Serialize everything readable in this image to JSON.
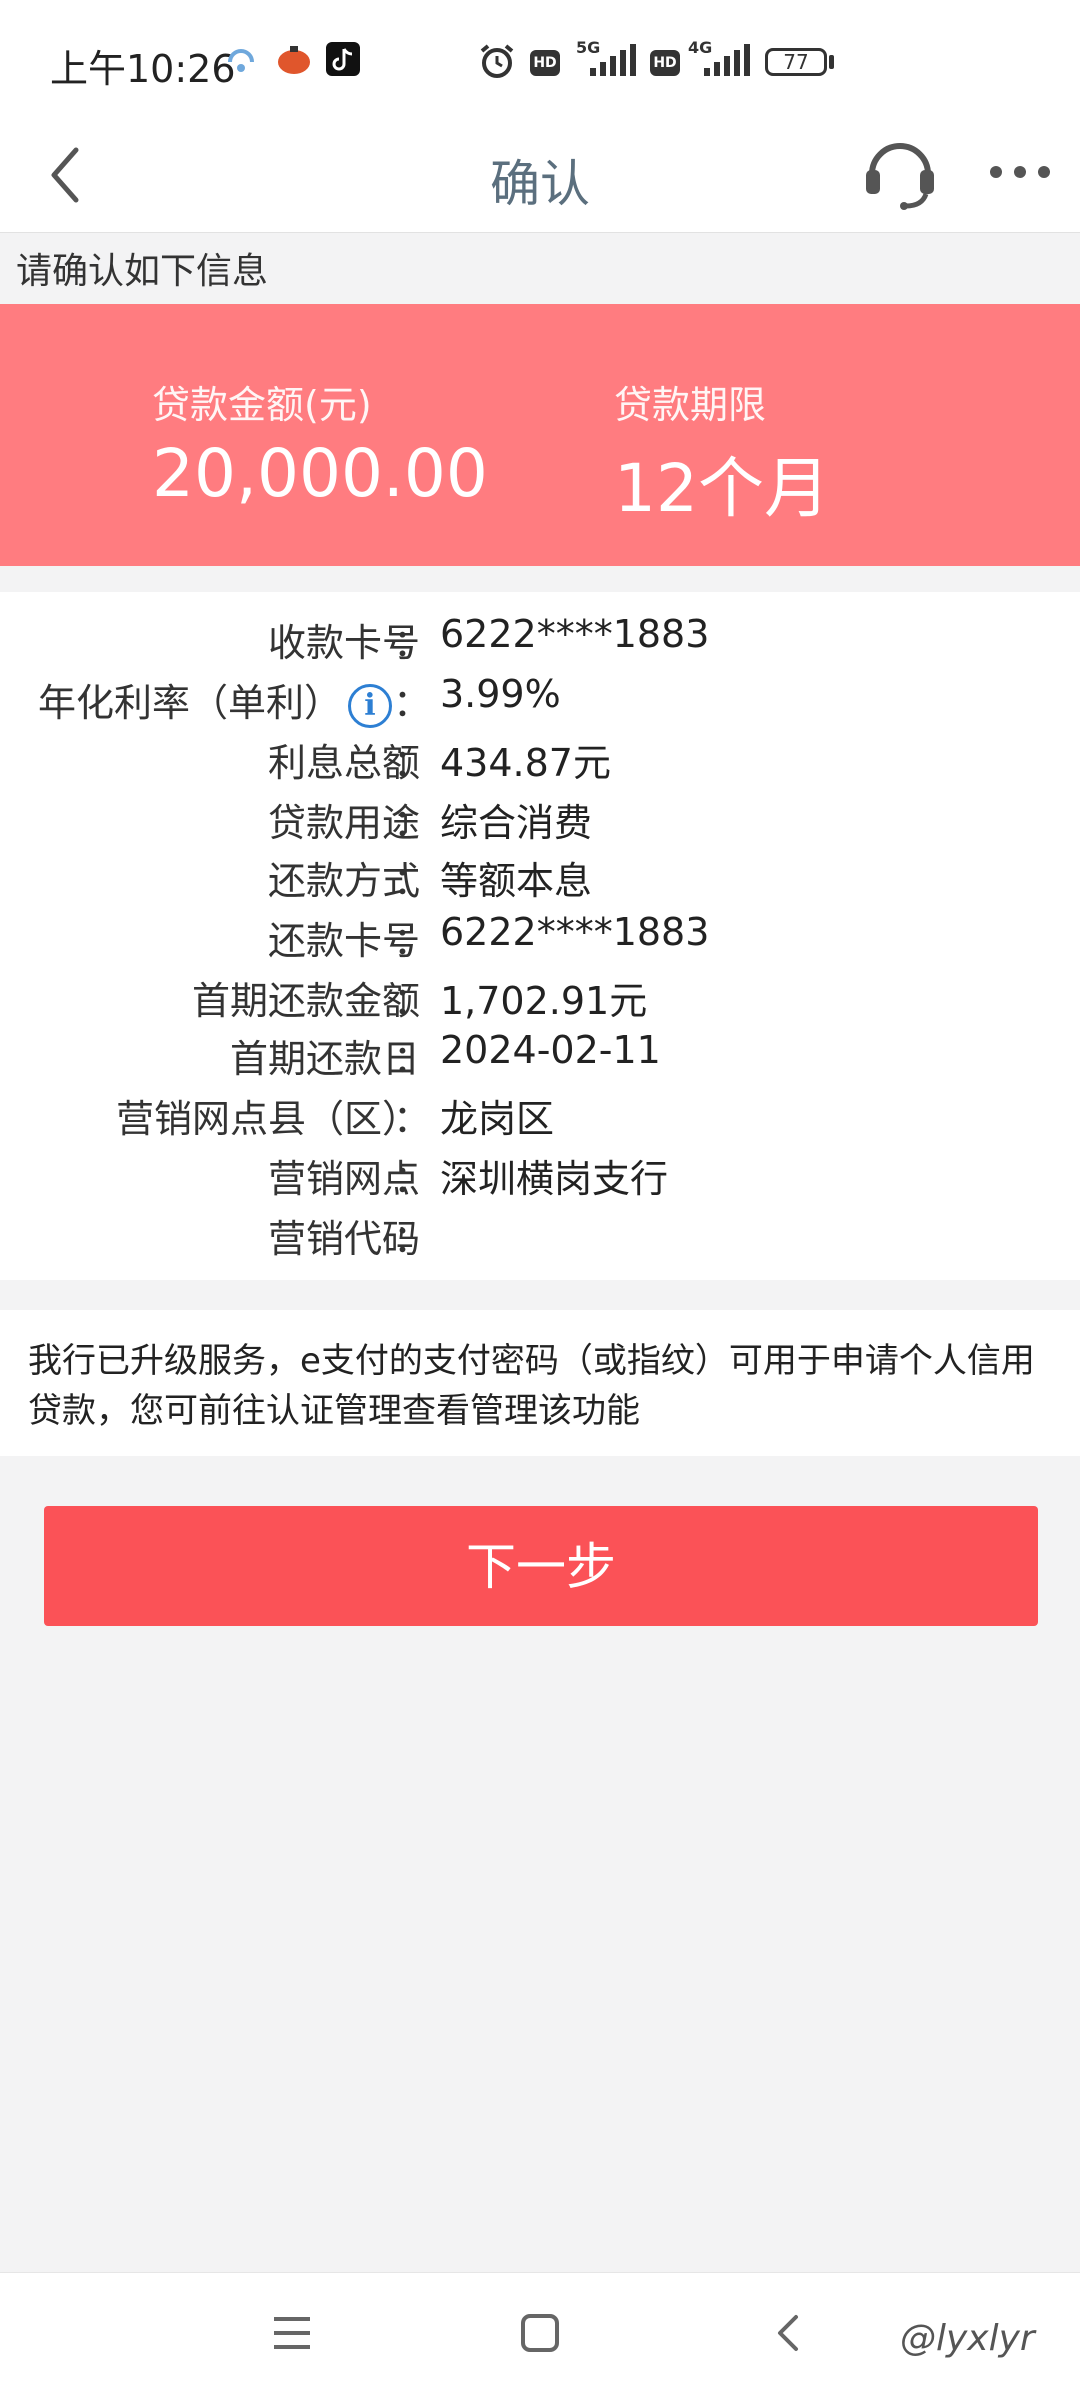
{
  "status_bar": {
    "time": "上午10:26",
    "battery": "77",
    "net1": "5G",
    "net2": "4G",
    "hd": "HD"
  },
  "nav": {
    "title": "确认"
  },
  "confirm_hint": "请确认如下信息",
  "summary": {
    "amount_label": "贷款金额(元)",
    "amount_value": "20,000.00",
    "term_label": "贷款期限",
    "term_value": "12个月"
  },
  "details": [
    {
      "label": "收款卡号",
      "value": "6222****1883"
    },
    {
      "label": "年化利率（单利）",
      "value": "3.99%"
    },
    {
      "label": "利息总额",
      "value": "434.87元"
    },
    {
      "label": "贷款用途",
      "value": "综合消费"
    },
    {
      "label": "还款方式",
      "value": "等额本息"
    },
    {
      "label": "还款卡号",
      "value": "6222****1883"
    },
    {
      "label": "首期还款金额",
      "value": "1,702.91元"
    },
    {
      "label": "首期还款日",
      "value": "2024-02-11"
    },
    {
      "label": "营销网点县（区）",
      "value": "龙岗区"
    },
    {
      "label": "营销网点",
      "value": "深圳横岗支行"
    },
    {
      "label": "营销代码",
      "value": ""
    }
  ],
  "colon": "：",
  "info_icon_glyph": "i",
  "notice": "我行已升级服务，e支付的支付密码（或指纹）可用于申请个人信用贷款，您可前往认证管理查看管理该功能",
  "next_button_label": "下一步",
  "watermark": "@lyxlyr",
  "colors": {
    "accent_red": "#fb5257",
    "summary_bg": "#ff7c80",
    "info_blue": "#2d7fd3"
  }
}
